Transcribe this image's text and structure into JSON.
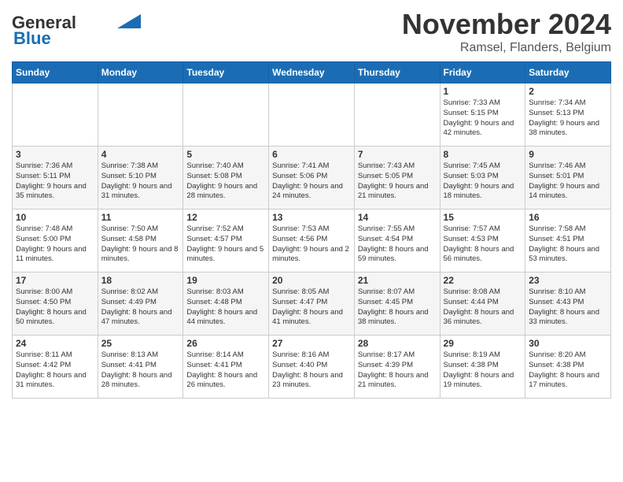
{
  "header": {
    "logo_line1": "General",
    "logo_line2": "Blue",
    "month_title": "November 2024",
    "location": "Ramsel, Flanders, Belgium"
  },
  "weekdays": [
    "Sunday",
    "Monday",
    "Tuesday",
    "Wednesday",
    "Thursday",
    "Friday",
    "Saturday"
  ],
  "weeks": [
    [
      {
        "day": "",
        "info": ""
      },
      {
        "day": "",
        "info": ""
      },
      {
        "day": "",
        "info": ""
      },
      {
        "day": "",
        "info": ""
      },
      {
        "day": "",
        "info": ""
      },
      {
        "day": "1",
        "info": "Sunrise: 7:33 AM\nSunset: 5:15 PM\nDaylight: 9 hours and 42 minutes."
      },
      {
        "day": "2",
        "info": "Sunrise: 7:34 AM\nSunset: 5:13 PM\nDaylight: 9 hours and 38 minutes."
      }
    ],
    [
      {
        "day": "3",
        "info": "Sunrise: 7:36 AM\nSunset: 5:11 PM\nDaylight: 9 hours and 35 minutes."
      },
      {
        "day": "4",
        "info": "Sunrise: 7:38 AM\nSunset: 5:10 PM\nDaylight: 9 hours and 31 minutes."
      },
      {
        "day": "5",
        "info": "Sunrise: 7:40 AM\nSunset: 5:08 PM\nDaylight: 9 hours and 28 minutes."
      },
      {
        "day": "6",
        "info": "Sunrise: 7:41 AM\nSunset: 5:06 PM\nDaylight: 9 hours and 24 minutes."
      },
      {
        "day": "7",
        "info": "Sunrise: 7:43 AM\nSunset: 5:05 PM\nDaylight: 9 hours and 21 minutes."
      },
      {
        "day": "8",
        "info": "Sunrise: 7:45 AM\nSunset: 5:03 PM\nDaylight: 9 hours and 18 minutes."
      },
      {
        "day": "9",
        "info": "Sunrise: 7:46 AM\nSunset: 5:01 PM\nDaylight: 9 hours and 14 minutes."
      }
    ],
    [
      {
        "day": "10",
        "info": "Sunrise: 7:48 AM\nSunset: 5:00 PM\nDaylight: 9 hours and 11 minutes."
      },
      {
        "day": "11",
        "info": "Sunrise: 7:50 AM\nSunset: 4:58 PM\nDaylight: 9 hours and 8 minutes."
      },
      {
        "day": "12",
        "info": "Sunrise: 7:52 AM\nSunset: 4:57 PM\nDaylight: 9 hours and 5 minutes."
      },
      {
        "day": "13",
        "info": "Sunrise: 7:53 AM\nSunset: 4:56 PM\nDaylight: 9 hours and 2 minutes."
      },
      {
        "day": "14",
        "info": "Sunrise: 7:55 AM\nSunset: 4:54 PM\nDaylight: 8 hours and 59 minutes."
      },
      {
        "day": "15",
        "info": "Sunrise: 7:57 AM\nSunset: 4:53 PM\nDaylight: 8 hours and 56 minutes."
      },
      {
        "day": "16",
        "info": "Sunrise: 7:58 AM\nSunset: 4:51 PM\nDaylight: 8 hours and 53 minutes."
      }
    ],
    [
      {
        "day": "17",
        "info": "Sunrise: 8:00 AM\nSunset: 4:50 PM\nDaylight: 8 hours and 50 minutes."
      },
      {
        "day": "18",
        "info": "Sunrise: 8:02 AM\nSunset: 4:49 PM\nDaylight: 8 hours and 47 minutes."
      },
      {
        "day": "19",
        "info": "Sunrise: 8:03 AM\nSunset: 4:48 PM\nDaylight: 8 hours and 44 minutes."
      },
      {
        "day": "20",
        "info": "Sunrise: 8:05 AM\nSunset: 4:47 PM\nDaylight: 8 hours and 41 minutes."
      },
      {
        "day": "21",
        "info": "Sunrise: 8:07 AM\nSunset: 4:45 PM\nDaylight: 8 hours and 38 minutes."
      },
      {
        "day": "22",
        "info": "Sunrise: 8:08 AM\nSunset: 4:44 PM\nDaylight: 8 hours and 36 minutes."
      },
      {
        "day": "23",
        "info": "Sunrise: 8:10 AM\nSunset: 4:43 PM\nDaylight: 8 hours and 33 minutes."
      }
    ],
    [
      {
        "day": "24",
        "info": "Sunrise: 8:11 AM\nSunset: 4:42 PM\nDaylight: 8 hours and 31 minutes."
      },
      {
        "day": "25",
        "info": "Sunrise: 8:13 AM\nSunset: 4:41 PM\nDaylight: 8 hours and 28 minutes."
      },
      {
        "day": "26",
        "info": "Sunrise: 8:14 AM\nSunset: 4:41 PM\nDaylight: 8 hours and 26 minutes."
      },
      {
        "day": "27",
        "info": "Sunrise: 8:16 AM\nSunset: 4:40 PM\nDaylight: 8 hours and 23 minutes."
      },
      {
        "day": "28",
        "info": "Sunrise: 8:17 AM\nSunset: 4:39 PM\nDaylight: 8 hours and 21 minutes."
      },
      {
        "day": "29",
        "info": "Sunrise: 8:19 AM\nSunset: 4:38 PM\nDaylight: 8 hours and 19 minutes."
      },
      {
        "day": "30",
        "info": "Sunrise: 8:20 AM\nSunset: 4:38 PM\nDaylight: 8 hours and 17 minutes."
      }
    ]
  ]
}
